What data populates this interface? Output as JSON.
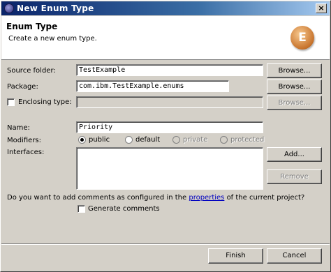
{
  "window": {
    "title": "New Enum Type",
    "close_symbol": "×"
  },
  "banner": {
    "title": "Enum Type",
    "subtitle": "Create a new enum type.",
    "icon_letter": "E"
  },
  "form": {
    "source_folder_label": "Source folder:",
    "source_folder_value": "TestExample",
    "package_label": "Package:",
    "package_value": "com.ibm.TestExample.enums",
    "enclosing_type_label": "Enclosing type:",
    "enclosing_type_value": "",
    "name_label": "Name:",
    "name_value": "Priority",
    "modifiers_label": "Modifiers:",
    "modifiers": [
      {
        "label": "public",
        "selected": true,
        "enabled": true
      },
      {
        "label": "default",
        "selected": false,
        "enabled": true
      },
      {
        "label": "private",
        "selected": false,
        "enabled": false
      },
      {
        "label": "protected",
        "selected": false,
        "enabled": false
      }
    ],
    "interfaces_label": "Interfaces:",
    "comments_prefix": "Do you want to add comments as configured in the",
    "comments_link": "properties",
    "comments_suffix": "of the current project?",
    "generate_comments_label": "Generate comments"
  },
  "buttons": {
    "browse": "Browse...",
    "add": "Add...",
    "remove": "Remove",
    "finish": "Finish",
    "cancel": "Cancel"
  }
}
